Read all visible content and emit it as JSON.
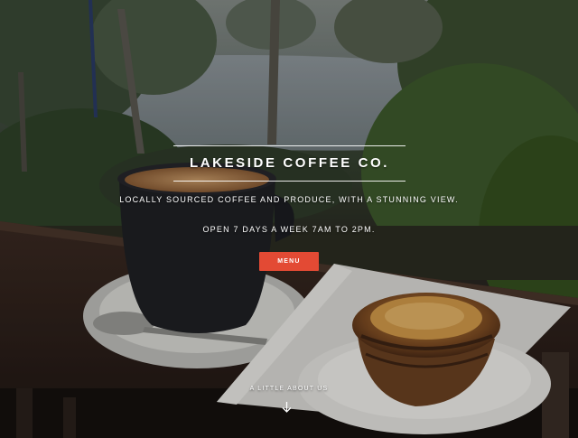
{
  "hero": {
    "title": "LAKESIDE COFFEE CO.",
    "tagline": "LOCALLY SOURCED COFFEE AND PRODUCE, WITH A STUNNING VIEW.",
    "hours": "OPEN 7 DAYS A WEEK 7AM TO 2PM.",
    "menu_button": "MENU",
    "scroll_link": "A LITTLE ABOUT US",
    "scroll_icon": "arrow-down-icon"
  },
  "colors": {
    "button": "#e34a34",
    "text": "#ffffff"
  }
}
